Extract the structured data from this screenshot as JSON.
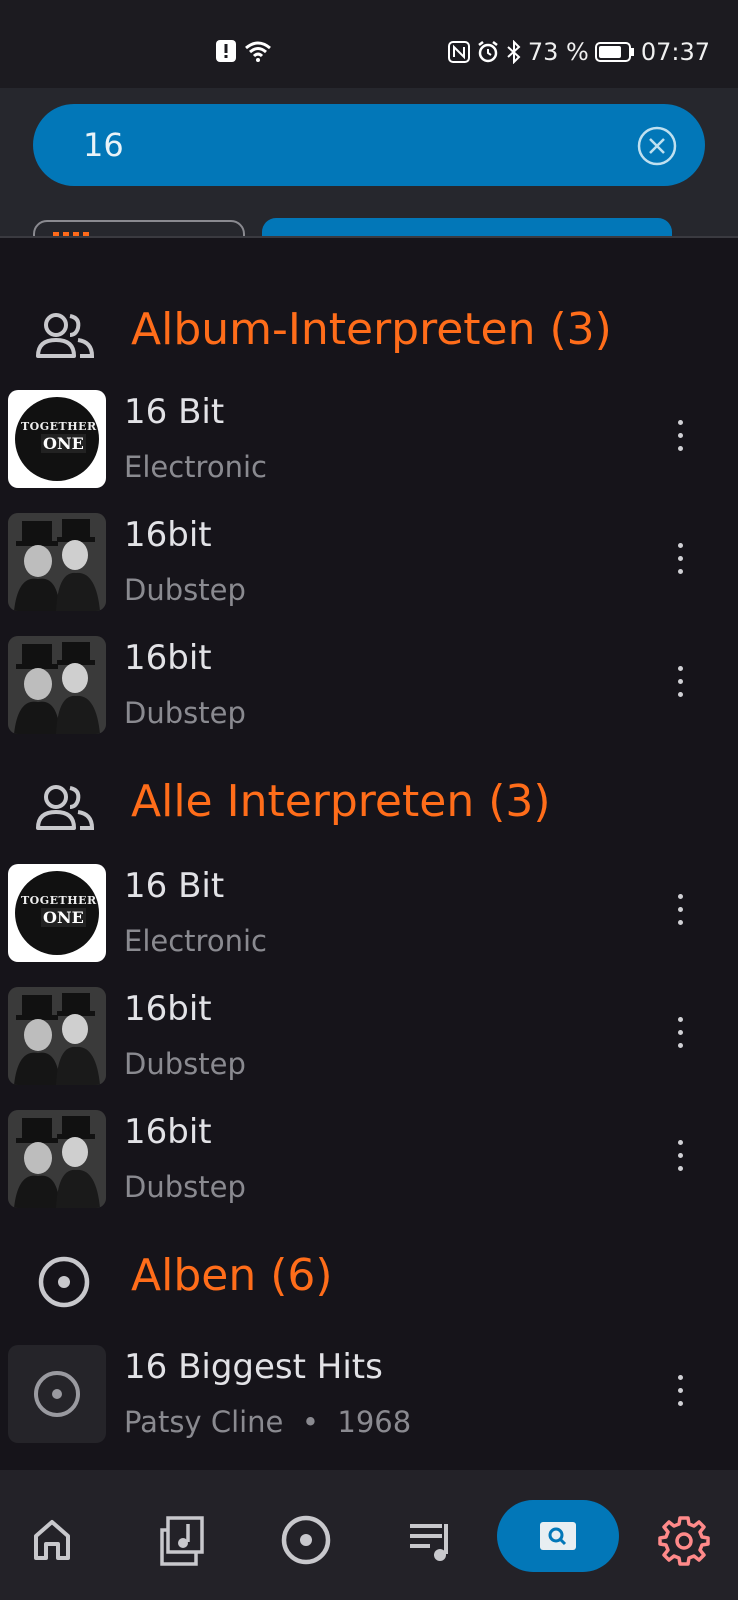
{
  "status_bar": {
    "battery": "73 %",
    "time": "07:37"
  },
  "search": {
    "query": "16"
  },
  "sections": [
    {
      "title": "Album-Interpreten (3)",
      "icon": "people-icon",
      "rows": [
        {
          "title": "16 Bit",
          "subtitle": "Electronic",
          "art": "together-one-logo"
        },
        {
          "title": "16bit",
          "subtitle": "Dubstep",
          "art": "band-photo"
        },
        {
          "title": "16bit",
          "subtitle": "Dubstep",
          "art": "band-photo"
        }
      ]
    },
    {
      "title": "Alle Interpreten (3)",
      "icon": "people-icon",
      "rows": [
        {
          "title": "16 Bit",
          "subtitle": "Electronic",
          "art": "together-one-logo"
        },
        {
          "title": "16bit",
          "subtitle": "Dubstep",
          "art": "band-photo"
        },
        {
          "title": "16bit",
          "subtitle": "Dubstep",
          "art": "band-photo"
        }
      ]
    },
    {
      "title": "Alben (6)",
      "icon": "disc-icon",
      "rows": [
        {
          "title": "16 Biggest Hits",
          "subtitle": "Patsy Cline  •  1968",
          "art": "disc-placeholder"
        }
      ]
    }
  ],
  "thumb_text": {
    "together": "TOGETHER",
    "one": "ONE"
  },
  "bottom_nav": [
    "home-icon",
    "library-icon",
    "disc-icon",
    "playlist-icon",
    "search-icon",
    "settings-icon"
  ],
  "colors": {
    "accent": "#ff6d1a",
    "primary": "#0277b8",
    "background": "#16141a"
  }
}
